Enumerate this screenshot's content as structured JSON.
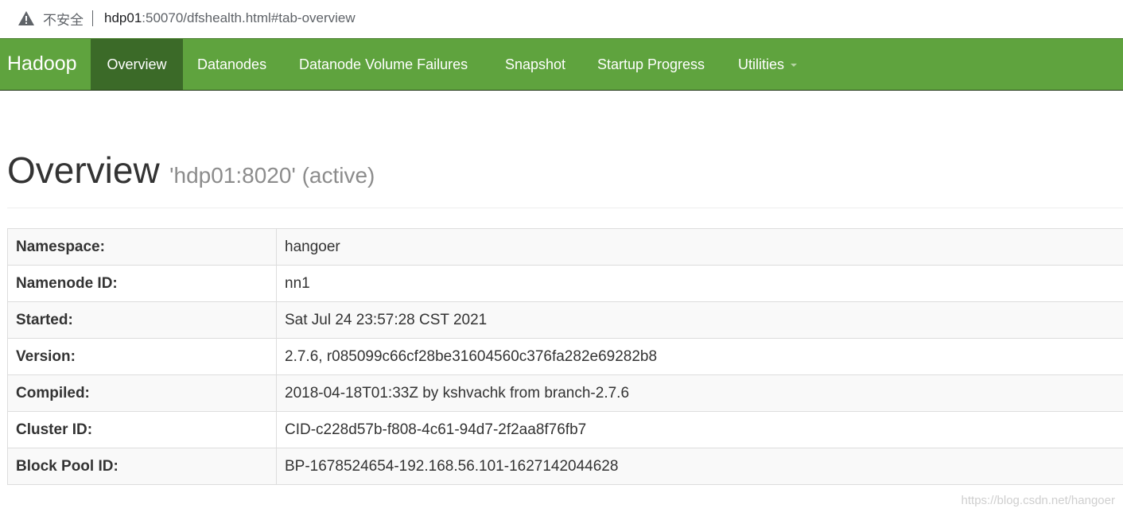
{
  "browser": {
    "security_label": "不安全",
    "url_host": "hdp01",
    "url_rest": ":50070/dfshealth.html#tab-overview"
  },
  "navbar": {
    "brand": "Hadoop",
    "items": [
      {
        "label": "Overview",
        "active": true
      },
      {
        "label": "Datanodes"
      },
      {
        "label": "Datanode Volume Failures"
      },
      {
        "label": "Snapshot"
      },
      {
        "label": "Startup Progress"
      },
      {
        "label": "Utilities",
        "dropdown": true
      }
    ]
  },
  "header": {
    "title": "Overview",
    "subtitle": "'hdp01:8020' (active)"
  },
  "overview_table": {
    "rows": [
      {
        "label": "Namespace:",
        "value": "hangoer"
      },
      {
        "label": "Namenode ID:",
        "value": "nn1"
      },
      {
        "label": "Started:",
        "value": "Sat Jul 24 23:57:28 CST 2021"
      },
      {
        "label": "Version:",
        "value": "2.7.6, r085099c66cf28be31604560c376fa282e69282b8"
      },
      {
        "label": "Compiled:",
        "value": "2018-04-18T01:33Z by kshvachk from branch-2.7.6"
      },
      {
        "label": "Cluster ID:",
        "value": "CID-c228d57b-f808-4c61-94d7-2f2aa8f76fb7"
      },
      {
        "label": "Block Pool ID:",
        "value": "BP-1678524654-192.168.56.101-1627142044628"
      }
    ]
  },
  "watermark": "https://blog.csdn.net/hangoer",
  "colors": {
    "navbar_bg": "#5fa33e",
    "navbar_active_bg": "#3b6a28",
    "warning_icon": "#5f6368"
  },
  "icons": {
    "security": "warning-triangle-icon",
    "dropdown": "caret-down-icon"
  }
}
